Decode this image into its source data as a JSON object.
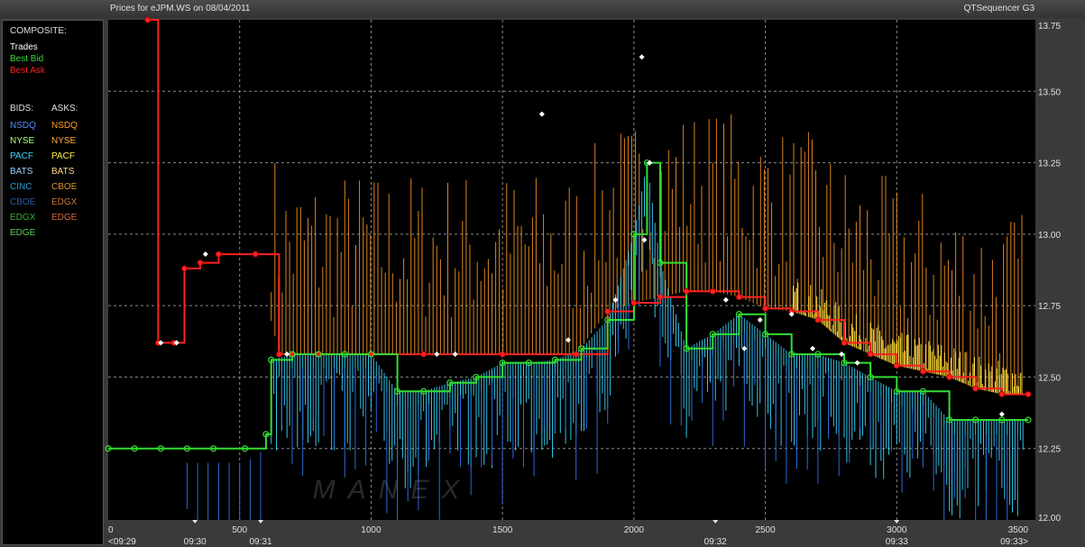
{
  "window": {
    "title": "Prices for  eJPM.WS  on  08/04/2011",
    "app_name": "QTSequencer G3"
  },
  "legend": {
    "composite_header": "COMPOSITE:",
    "composite": [
      {
        "label": "Trades",
        "color": "#ffffff"
      },
      {
        "label": "Best Bid",
        "color": "#33dd33"
      },
      {
        "label": "Best Ask",
        "color": "#ff2222"
      }
    ],
    "bids_header": "BIDS:",
    "asks_header": "ASKS:",
    "bids": [
      {
        "label": "NSDQ",
        "color": "#4a8cff"
      },
      {
        "label": "NYSE",
        "color": "#a8ff7a"
      },
      {
        "label": "PACF",
        "color": "#3ad8ff"
      },
      {
        "label": "BATS",
        "color": "#9ad0ff"
      },
      {
        "label": "CINC",
        "color": "#2a9ad8"
      },
      {
        "label": "CBOE",
        "color": "#2a5aaa"
      },
      {
        "label": "EDGX",
        "color": "#3aa83a"
      },
      {
        "label": "EDGE",
        "color": "#5acc5a"
      }
    ],
    "asks": [
      {
        "label": "NSDQ",
        "color": "#ff9a22"
      },
      {
        "label": "NYSE",
        "color": "#ffaa44"
      },
      {
        "label": "PACF",
        "color": "#ffee44"
      },
      {
        "label": "BATS",
        "color": "#ffd88a"
      },
      {
        "label": "CBOE",
        "color": "#d8922a"
      },
      {
        "label": "EDGX",
        "color": "#c87a3a"
      },
      {
        "label": "EDGE",
        "color": "#d86a3a"
      }
    ]
  },
  "watermark": "MANEX",
  "chart_data": {
    "type": "line",
    "title": "Prices for  eJPM.WS  on  08/04/2011",
    "xlim": [
      0,
      3500
    ],
    "ylim": [
      12.0,
      13.75
    ],
    "x_ticks": [
      0,
      500,
      1000,
      1500,
      2000,
      2500,
      3000,
      3500
    ],
    "x_tick_labels": [
      "0",
      "500",
      "1000",
      "1500",
      "2000",
      "2500",
      "3000",
      "3500"
    ],
    "time_labels": [
      {
        "x": 0,
        "label": "<09:29"
      },
      {
        "x": 330,
        "label": "09:30"
      },
      {
        "x": 580,
        "label": "09:31"
      },
      {
        "x": 2310,
        "label": "09:32"
      },
      {
        "x": 3000,
        "label": "09:33"
      },
      {
        "x": 3500,
        "label": "09:33>"
      }
    ],
    "y_ticks": [
      12.0,
      12.25,
      12.5,
      12.75,
      13.0,
      13.25,
      13.5,
      13.75
    ],
    "y_tick_labels": [
      "12.00",
      "12.25",
      "12.50",
      "12.75",
      "13.00",
      "13.25",
      "13.50",
      "13.75"
    ],
    "grid": true,
    "series": [
      {
        "name": "Best Ask",
        "color": "#ff2222",
        "x": [
          150,
          190,
          250,
          290,
          350,
          420,
          560,
          650,
          700,
          800,
          1000,
          1200,
          1500,
          1780,
          1900,
          2000,
          2100,
          2200,
          2300,
          2400,
          2500,
          2600,
          2700,
          2800,
          2900,
          3000,
          3100,
          3200,
          3300,
          3400,
          3500
        ],
        "y": [
          13.75,
          12.62,
          12.62,
          12.88,
          12.9,
          12.93,
          12.93,
          12.58,
          12.58,
          12.58,
          12.58,
          12.58,
          12.58,
          12.58,
          12.73,
          12.76,
          12.78,
          12.8,
          12.8,
          12.78,
          12.74,
          12.73,
          12.7,
          12.62,
          12.58,
          12.54,
          12.52,
          12.5,
          12.46,
          12.44,
          12.44
        ]
      },
      {
        "name": "Best Bid",
        "color": "#33dd33",
        "x": [
          0,
          100,
          200,
          300,
          400,
          520,
          600,
          620,
          700,
          800,
          900,
          1000,
          1100,
          1200,
          1300,
          1400,
          1500,
          1600,
          1700,
          1800,
          1900,
          2000,
          2050,
          2100,
          2200,
          2300,
          2400,
          2500,
          2600,
          2700,
          2800,
          2900,
          3000,
          3100,
          3200,
          3300,
          3400,
          3500
        ],
        "y": [
          12.25,
          12.25,
          12.25,
          12.25,
          12.25,
          12.25,
          12.3,
          12.56,
          12.58,
          12.58,
          12.58,
          12.58,
          12.45,
          12.45,
          12.48,
          12.5,
          12.55,
          12.55,
          12.56,
          12.6,
          12.7,
          13.0,
          13.25,
          12.9,
          12.6,
          12.65,
          12.72,
          12.65,
          12.58,
          12.58,
          12.55,
          12.5,
          12.45,
          12.45,
          12.35,
          12.35,
          12.35,
          12.35
        ]
      },
      {
        "name": "Trades",
        "color": "#ffffff",
        "x": [
          200,
          260,
          370,
          680,
          1250,
          1320,
          1650,
          1750,
          1930,
          2030,
          2040,
          2060,
          2350,
          2420,
          2480,
          2600,
          2680,
          2790,
          2850,
          3400
        ],
        "y": [
          12.62,
          12.62,
          12.93,
          12.58,
          12.58,
          12.58,
          13.42,
          12.63,
          12.77,
          13.62,
          12.98,
          13.25,
          12.77,
          12.6,
          12.7,
          12.72,
          12.6,
          12.58,
          12.55,
          12.37
        ]
      }
    ]
  }
}
